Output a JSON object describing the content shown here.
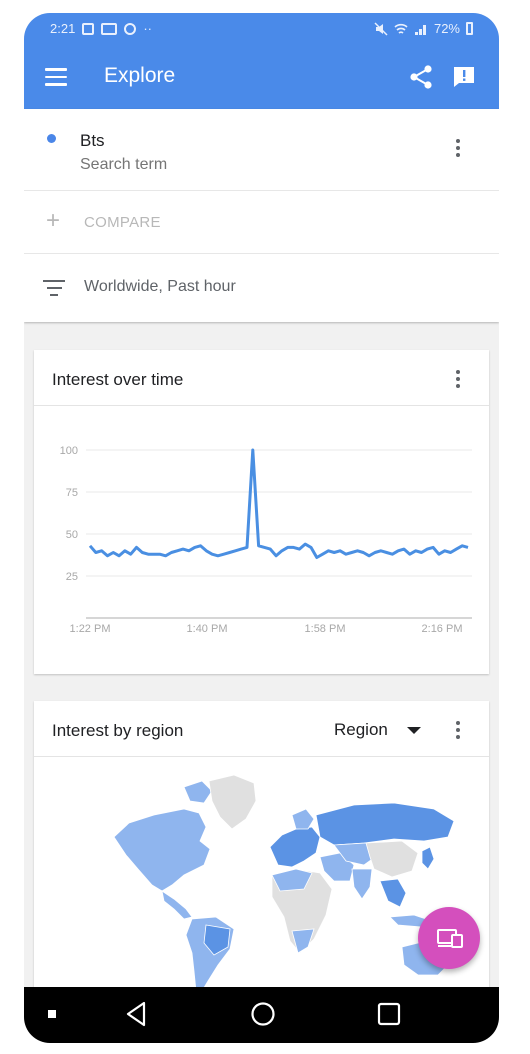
{
  "status_bar": {
    "time": "2:21",
    "more_dots": "··",
    "battery_percent": "72%"
  },
  "app_bar": {
    "title": "Explore",
    "icons": [
      "menu-icon",
      "share-icon",
      "feedback-icon"
    ]
  },
  "search": {
    "term": "Bts",
    "term_subtitle": "Search term",
    "term_color": "#4a86e8",
    "compare_label": "COMPARE",
    "filter_label": "Worldwide, Past hour"
  },
  "interest_over_time": {
    "title": "Interest over time",
    "chart_data": {
      "type": "line",
      "x_tick_labels": [
        "1:22 PM",
        "1:40 PM",
        "1:58 PM",
        "2:16 PM"
      ],
      "y_tick_labels": [
        "100",
        "75",
        "50",
        "25"
      ],
      "ylim": [
        0,
        100
      ],
      "grid": true,
      "color": "#4a8fe2",
      "series": [
        {
          "values": [
            43,
            39,
            40,
            37,
            39,
            37,
            40,
            38,
            42,
            39,
            38,
            38,
            38,
            37,
            39,
            40,
            41,
            40,
            42,
            43,
            40,
            38,
            37,
            38,
            39,
            40,
            41,
            42,
            100,
            43,
            42,
            41,
            37,
            40,
            42,
            42,
            41,
            44,
            42,
            36,
            38,
            40,
            39,
            40,
            38,
            39,
            40,
            39,
            37,
            39,
            40,
            39,
            38,
            40,
            41,
            38,
            40,
            39,
            41,
            42,
            38,
            40,
            39,
            41,
            43,
            42
          ]
        }
      ]
    }
  },
  "interest_by_region": {
    "title": "Interest by region",
    "selector_label": "Region",
    "map_colors": {
      "interest": "#8fb5ee",
      "interest_high": "#5b93e4",
      "no_data": "#e0e0e0"
    }
  },
  "fab": {
    "icon": "devices-icon",
    "color": "#d44fbd"
  },
  "nav_bar": {
    "icons": [
      "recents-square-icon",
      "back-icon",
      "home-icon",
      "overview-icon"
    ]
  }
}
